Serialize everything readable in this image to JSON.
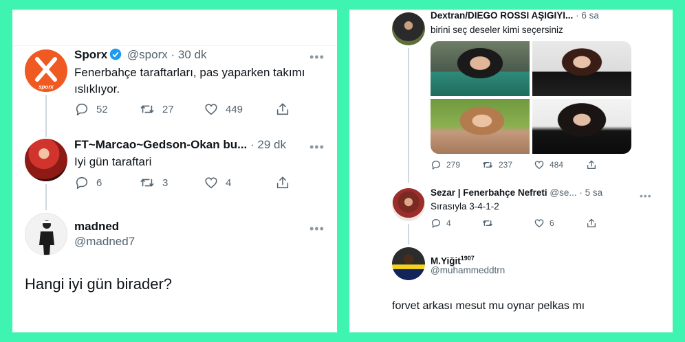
{
  "left": {
    "tweet1": {
      "name": "Sporx",
      "handle": "@sporx",
      "time": "· 30 dk",
      "text": "Fenerbahçe taraftarları, pas yaparken takımı ıslıklıyor.",
      "avatar_label": "sporx",
      "replies": "52",
      "retweets": "27",
      "likes": "449"
    },
    "tweet2": {
      "name": "FT~Marcao~Gedson-Okan bu...",
      "time": "· 29 dk",
      "text": "Iyi gün taraftari",
      "replies": "6",
      "retweets": "3",
      "likes": "4"
    },
    "tweet3": {
      "name": "madned",
      "handle": "@madned7",
      "text": "Hangi iyi gün birader?"
    }
  },
  "right": {
    "tweet1": {
      "name": "Dextran/DIEGO ROSSI AŞIGIYI...",
      "time": "· 6 sa",
      "text": "birini seç deseler kimi seçersiniz",
      "replies": "279",
      "retweets": "237",
      "likes": "484"
    },
    "tweet2": {
      "name": "Sezar | Fenerbahçe Nefreti",
      "handle": "@se...",
      "time": "· 5 sa",
      "text": "Sırasıyla 3-4-1-2",
      "replies": "4",
      "likes": "6"
    },
    "tweet3": {
      "name": "M.Yiğit",
      "name_sup": "1907",
      "handle": "@muhammeddtrn",
      "text": "forvet arkası mesut mu oynar pelkas mı"
    }
  },
  "icons": {
    "reply": "reply-icon",
    "retweet": "retweet-icon",
    "like": "like-icon",
    "share": "share-icon",
    "verified": "verified-badge-icon",
    "more": "more-options-icon"
  },
  "colors": {
    "frame": "#3ff3b0",
    "sporx_orange": "#f05a22",
    "verified_blue": "#1d9bf0",
    "muted": "#536471"
  }
}
